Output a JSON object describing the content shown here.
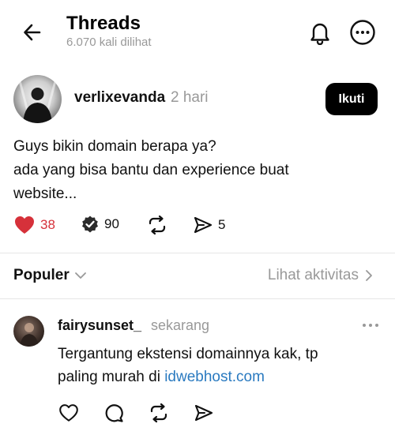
{
  "header": {
    "title": "Threads",
    "views": "6.070 kali dilihat",
    "back_icon": "arrow-left-icon",
    "notification_icon": "bell-icon",
    "more_icon": "more-horizontal-circle-icon"
  },
  "post": {
    "username": "verlixevanda",
    "time": "2 hari",
    "follow_label": "Ikuti",
    "text_lines": [
      "Guys bikin domain berapa ya?",
      "ada yang bisa bantu dan experience buat",
      "website..."
    ],
    "likes": "38",
    "quotes": "90",
    "shares": "5"
  },
  "replies_header": {
    "sort_label": "Populer",
    "activity_label": "Lihat aktivitas"
  },
  "reply": {
    "username": "fairysunset_",
    "time": "sekarang",
    "text_line1": "Tergantung ekstensi domainnya kak, tp",
    "text_line2_prefix": "paling murah di ",
    "link_text": "idwebhost.com"
  },
  "colors": {
    "like": "#d6313a",
    "link": "#2a7ac0",
    "muted": "#999999",
    "follow_bg": "#000000"
  }
}
